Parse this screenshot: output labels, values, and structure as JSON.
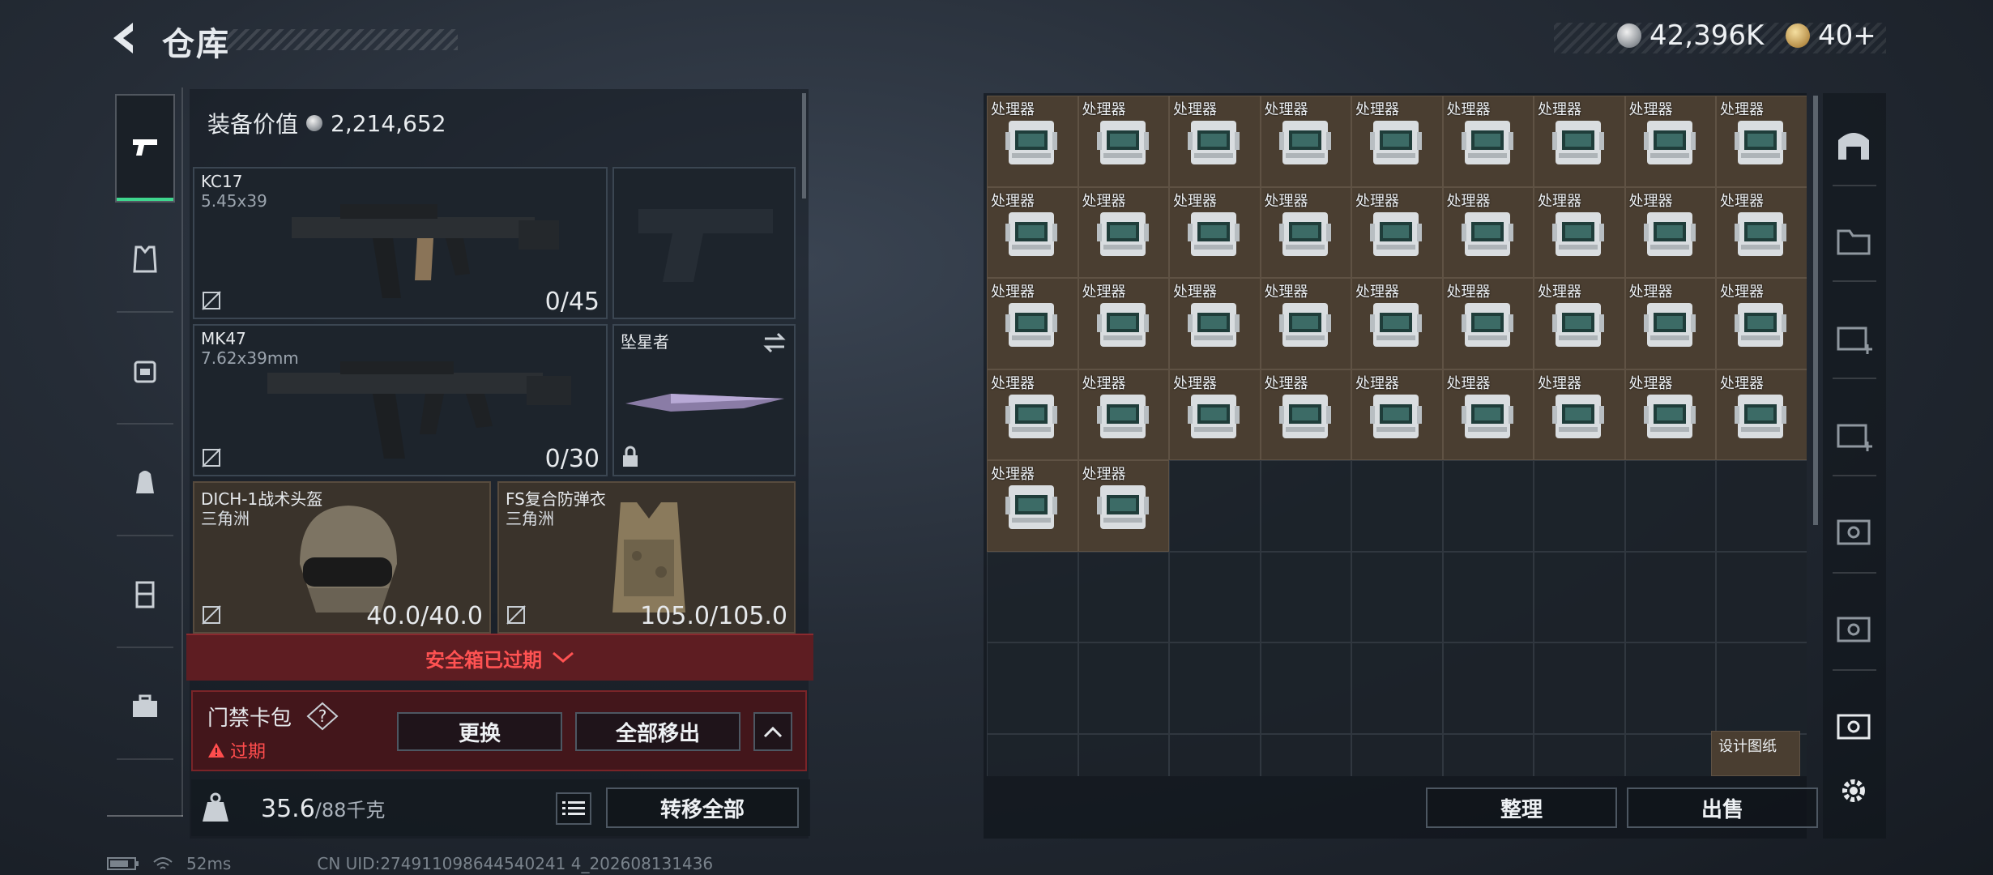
{
  "header": {
    "title": "仓库",
    "currency": [
      {
        "name": "silver-coin",
        "value": "42,396K"
      },
      {
        "name": "gold-coin",
        "value": "40+"
      }
    ]
  },
  "equip": {
    "value_label": "装备价值",
    "value": "2,214,652",
    "primary": {
      "name": "KC17",
      "caliber": "5.45x39",
      "ammo": "0/45"
    },
    "secondary": {
      "name": "MK47",
      "caliber": "7.62x39mm",
      "ammo": "0/30"
    },
    "melee": {
      "name": "坠星者"
    },
    "helmet": {
      "name": "DICH-1战术头盔",
      "faction": "三角洲",
      "durability": "40.0/40.0"
    },
    "armor": {
      "name": "FS复合防弹衣",
      "faction": "三角洲",
      "durability": "105.0/105.0"
    }
  },
  "safe_box": {
    "status": "安全箱已过期"
  },
  "card_pack": {
    "title": "门禁卡包",
    "help": "?",
    "status": "过期",
    "replace_label": "更换",
    "remove_all_label": "全部移出"
  },
  "weight": {
    "current": "35.6",
    "max": "/88千克",
    "transfer_all_label": "转移全部"
  },
  "stash": {
    "item_label": "处理器",
    "item_count": 38,
    "blueprint_label": "设计图纸",
    "sort_label": "整理",
    "sell_label": "出售"
  },
  "footer": {
    "ping": "52ms",
    "uid": "CN UID:274911098644540241 4_202608131436"
  }
}
